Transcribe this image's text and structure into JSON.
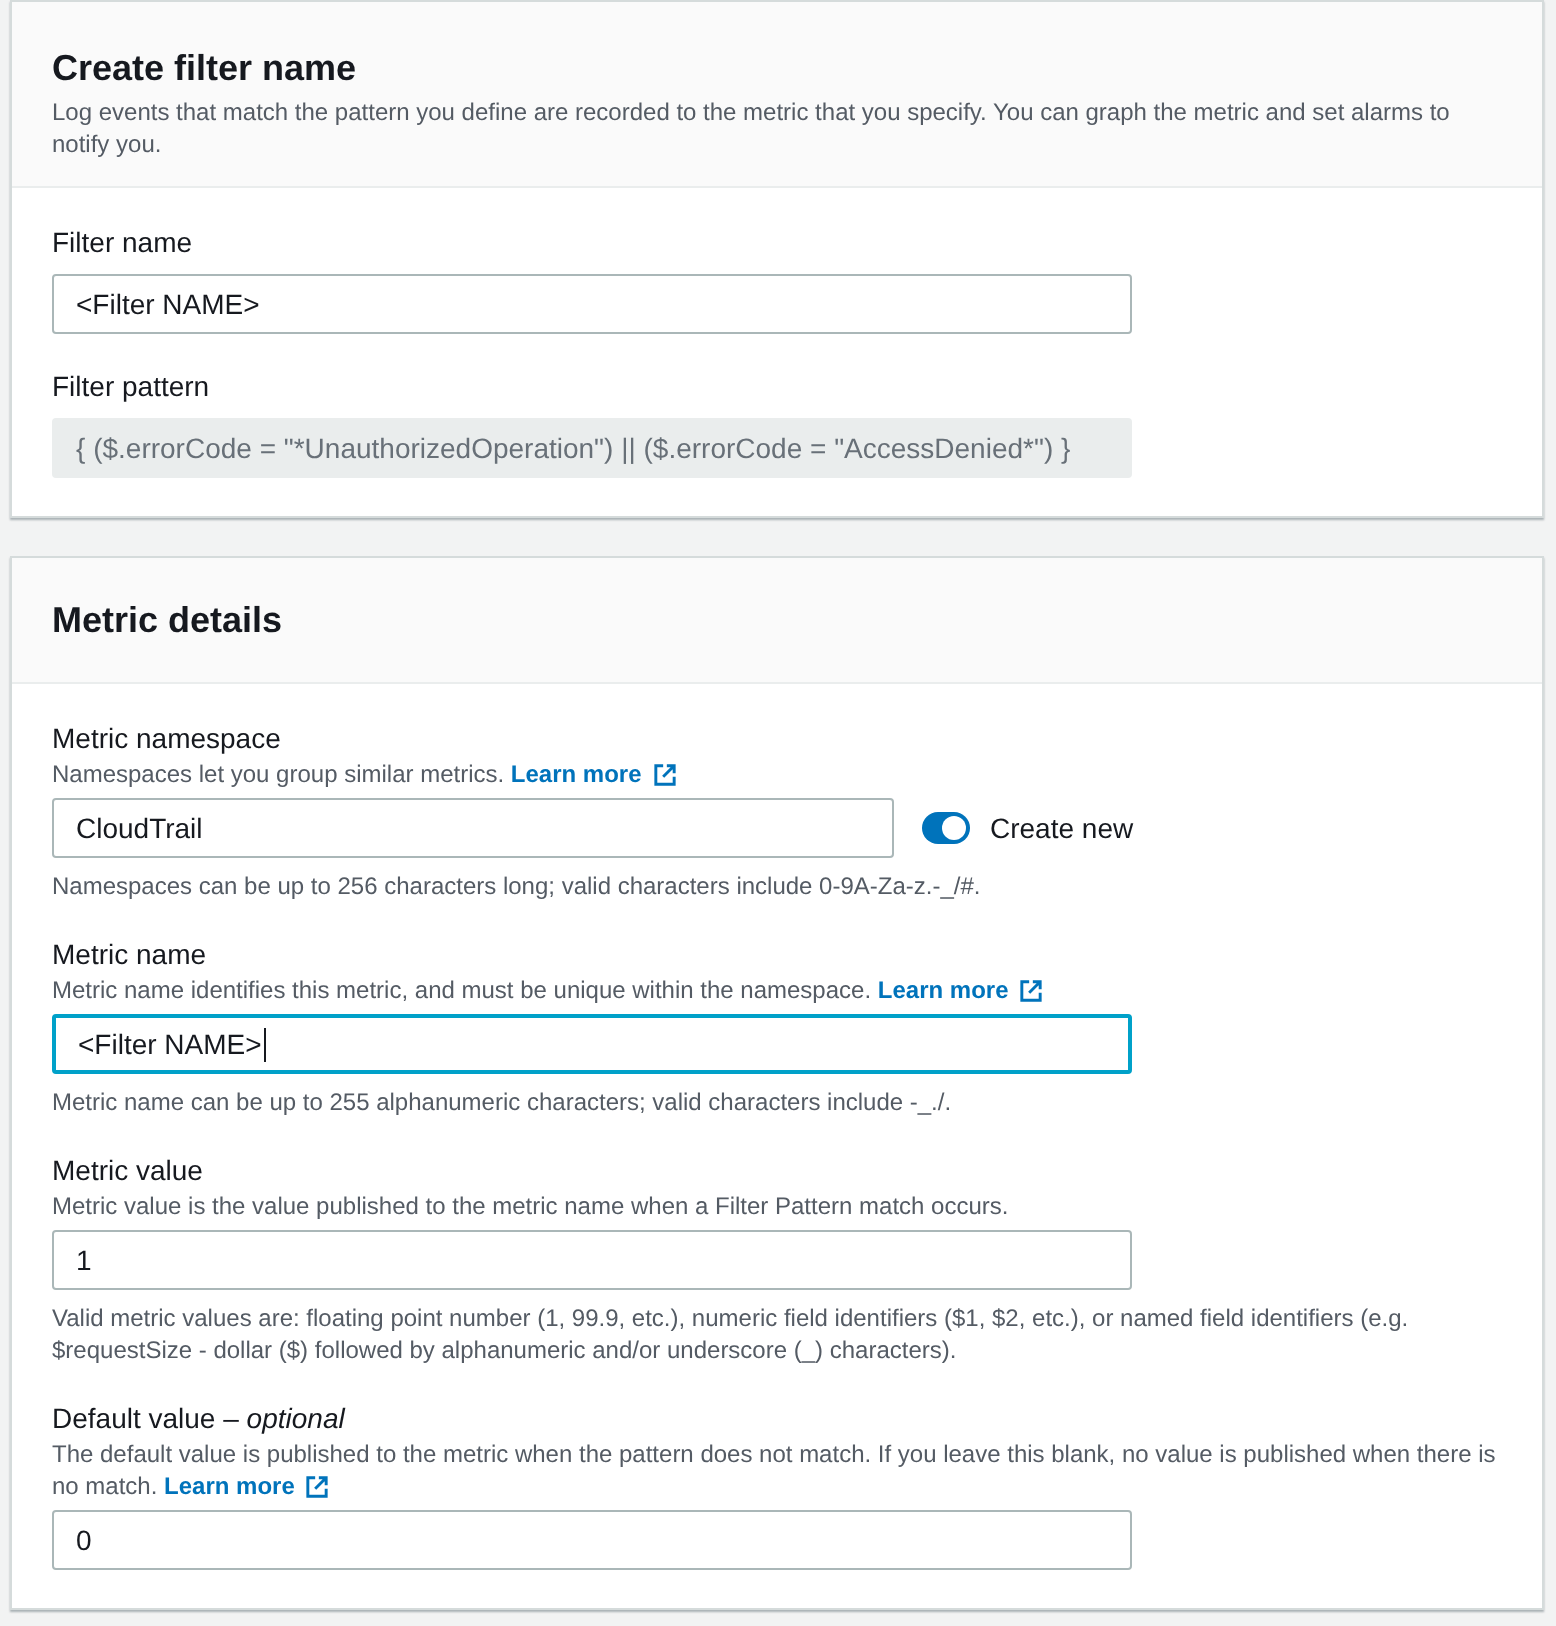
{
  "sections": [
    {
      "title": "Create filter name",
      "description": "Log events that match the pattern you define are recorded to the metric that you specify. You can graph the metric and set alarms to notify you.",
      "fields": [
        {
          "kind": "input",
          "label": "Filter name",
          "value": "<Filter NAME>",
          "focused": false
        },
        {
          "kind": "readonly",
          "label": "Filter pattern",
          "value": "{ ($.errorCode = \"*UnauthorizedOperation\") || ($.errorCode = \"AccessDenied*\") }"
        }
      ]
    },
    {
      "title": "Metric details",
      "fields": [
        {
          "kind": "input",
          "label": "Metric namespace",
          "description": "Namespaces let you group similar metrics.",
          "link": "Learn more",
          "value": "CloudTrail",
          "focused": false,
          "toggle": {
            "label": "Create new",
            "on": true
          },
          "constraint": "Namespaces can be up to 256 characters long; valid characters include 0-9A-Za-z.-_/#."
        },
        {
          "kind": "input",
          "label": "Metric name",
          "description": "Metric name identifies this metric, and must be unique within the namespace.",
          "link": "Learn more",
          "value": "<Filter NAME>",
          "focused": true,
          "constraint": "Metric name can be up to 255 alphanumeric characters; valid characters include -_./."
        },
        {
          "kind": "input",
          "label": "Metric value",
          "description": "Metric value is the value published to the metric name when a Filter Pattern match occurs.",
          "value": "1",
          "focused": false,
          "constraint": "Valid metric values are: floating point number (1, 99.9, etc.), numeric field identifiers ($1, $2, etc.), or named field identifiers (e.g. $requestSize - dollar ($) followed by alphanumeric and/or underscore (_) characters)."
        },
        {
          "kind": "input",
          "label": "Default value – *optional*",
          "description": "The default value is published to the metric when the pattern does not match. If you leave this blank, no value is published when there is no match.",
          "link": "Learn more",
          "value": "0",
          "focused": false
        }
      ]
    }
  ]
}
